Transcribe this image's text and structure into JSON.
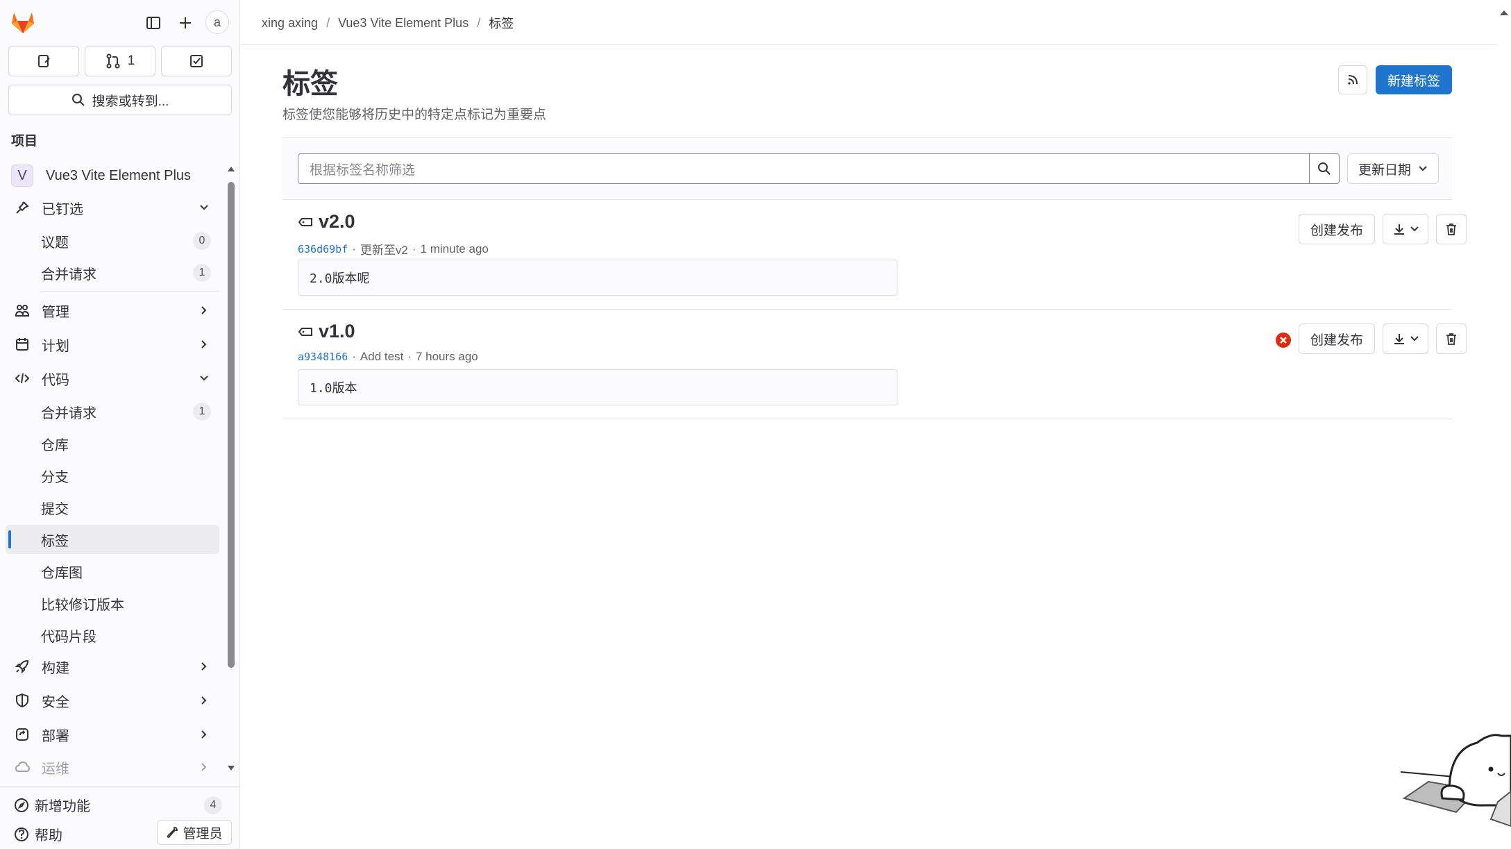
{
  "sidebar": {
    "counts": {
      "merge_requests": "1"
    },
    "search_label": "搜索或转到...",
    "section_title": "项目",
    "project_initial": "V",
    "project_name": "Vue3 Vite Element Plus",
    "pinned": {
      "label": "已钉选",
      "items": [
        {
          "label": "议题",
          "count": "0"
        },
        {
          "label": "合并请求",
          "count": "1"
        }
      ]
    },
    "groups": {
      "manage": "管理",
      "plan": "计划",
      "code": "代码",
      "build": "构建",
      "secure": "安全",
      "deploy": "部署",
      "operate": "运维"
    },
    "code_items": [
      {
        "label": "合并请求",
        "count": "1"
      },
      {
        "label": "仓库"
      },
      {
        "label": "分支"
      },
      {
        "label": "提交"
      },
      {
        "label": "标签"
      },
      {
        "label": "仓库图"
      },
      {
        "label": "比较修订版本"
      },
      {
        "label": "代码片段"
      }
    ],
    "whats_new": {
      "label": "新增功能",
      "count": "4"
    },
    "help": "帮助",
    "admin": "管理员",
    "avatar_alt": "a"
  },
  "breadcrumb": [
    "xing axing",
    "Vue3 Vite Element Plus",
    "标签"
  ],
  "page": {
    "title": "标签",
    "description": "标签使您能够将历史中的特定点标记为重要点",
    "new_tag_button": "新建标签"
  },
  "filter": {
    "placeholder": "根据标签名称筛选",
    "sort_label": "更新日期"
  },
  "tags": [
    {
      "name": "v2.0",
      "sha": "636d69bf",
      "commit_title": "更新至v2",
      "time": "1 minute ago",
      "message": "2.0版本呢",
      "release_button": "创建发布",
      "pipeline_status": ""
    },
    {
      "name": "v1.0",
      "sha": "a9348166",
      "commit_title": "Add test",
      "time": "7 hours ago",
      "message": "1.0版本",
      "release_button": "创建发布",
      "pipeline_status": "failed"
    }
  ],
  "colors": {
    "primary": "#1f75cb",
    "danger": "#dd2b0e",
    "text": "#333238"
  }
}
